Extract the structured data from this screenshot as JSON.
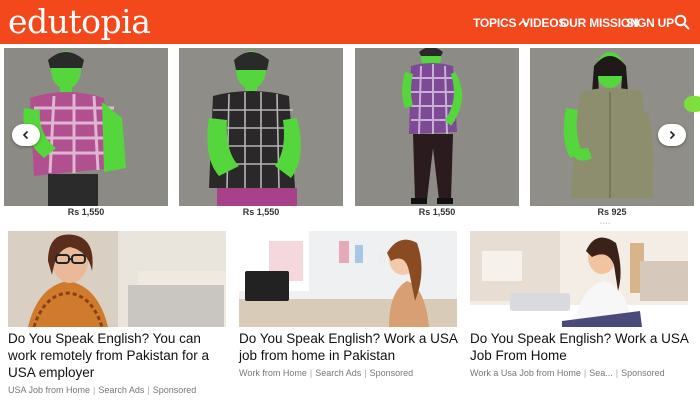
{
  "header": {
    "logo": "edutopia",
    "nav": [
      {
        "label": "TOPICS"
      },
      {
        "label": "VIDEOS"
      },
      {
        "label": "OUR MISSION"
      },
      {
        "label": "SIGN UP"
      }
    ],
    "background_color": "#f3471c"
  },
  "carousel": {
    "products": [
      {
        "price": "Rs 1,550",
        "shirt": "pink-plaid"
      },
      {
        "price": "Rs 1,550",
        "shirt": "black-plaid"
      },
      {
        "price": "Rs 1,550",
        "shirt": "purple-plaid"
      },
      {
        "price": "Rs 925",
        "shirt": "olive-blouse"
      }
    ],
    "dots": "••••",
    "prev_icon": "chevron-left-icon",
    "next_icon": "chevron-right-icon"
  },
  "ads": [
    {
      "title": "Do You Speak English? You can work remotely from Pakistan for a USA employer",
      "source": "USA Job from Home",
      "provider": "Search Ads",
      "sponsored": "Sponsored"
    },
    {
      "title": "Do You Speak English? Work a USA job from home in Pakistan",
      "source": "Work from Home",
      "provider": "Search Ads",
      "sponsored": "Sponsored"
    },
    {
      "title": "Do You Speak English? Work a USA Job From Home",
      "source": "Work a Usa Job from Home",
      "provider": "Sea...",
      "sponsored": "Sponsored"
    }
  ]
}
